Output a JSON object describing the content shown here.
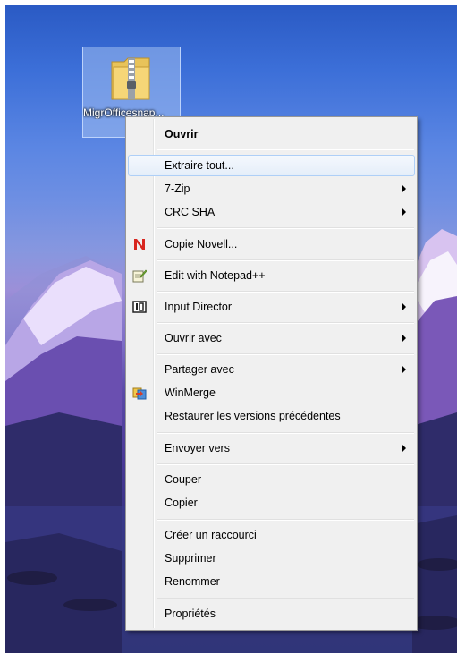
{
  "desktop": {
    "file_label": "MigrOfficesnap..."
  },
  "context_menu": {
    "items": [
      {
        "label": "Ouvrir",
        "bold": true,
        "submenu": false,
        "icon": null
      },
      {
        "label": "Extraire tout...",
        "bold": false,
        "submenu": false,
        "icon": null,
        "highlighted": true
      },
      {
        "label": "7-Zip",
        "bold": false,
        "submenu": true,
        "icon": null
      },
      {
        "label": "CRC SHA",
        "bold": false,
        "submenu": true,
        "icon": null
      },
      {
        "label": "Copie Novell...",
        "bold": false,
        "submenu": false,
        "icon": "novell-n-icon"
      },
      {
        "label": "Edit with Notepad++",
        "bold": false,
        "submenu": false,
        "icon": "notepad-plus-plus-icon"
      },
      {
        "label": "Input Director",
        "bold": false,
        "submenu": true,
        "icon": "input-director-icon"
      },
      {
        "label": "Ouvrir avec",
        "bold": false,
        "submenu": true,
        "icon": null
      },
      {
        "label": "Partager avec",
        "bold": false,
        "submenu": true,
        "icon": null
      },
      {
        "label": "WinMerge",
        "bold": false,
        "submenu": false,
        "icon": "winmerge-icon"
      },
      {
        "label": "Restaurer les versions précédentes",
        "bold": false,
        "submenu": false,
        "icon": null
      },
      {
        "label": "Envoyer vers",
        "bold": false,
        "submenu": true,
        "icon": null
      },
      {
        "label": "Couper",
        "bold": false,
        "submenu": false,
        "icon": null
      },
      {
        "label": "Copier",
        "bold": false,
        "submenu": false,
        "icon": null
      },
      {
        "label": "Créer un raccourci",
        "bold": false,
        "submenu": false,
        "icon": null
      },
      {
        "label": "Supprimer",
        "bold": false,
        "submenu": false,
        "icon": null
      },
      {
        "label": "Renommer",
        "bold": false,
        "submenu": false,
        "icon": null
      },
      {
        "label": "Propriétés",
        "bold": false,
        "submenu": false,
        "icon": null
      }
    ]
  },
  "colors": {
    "menu_background": "#f0f0f0",
    "highlight_border": "#aecff7",
    "novell_red": "#d8261f"
  }
}
